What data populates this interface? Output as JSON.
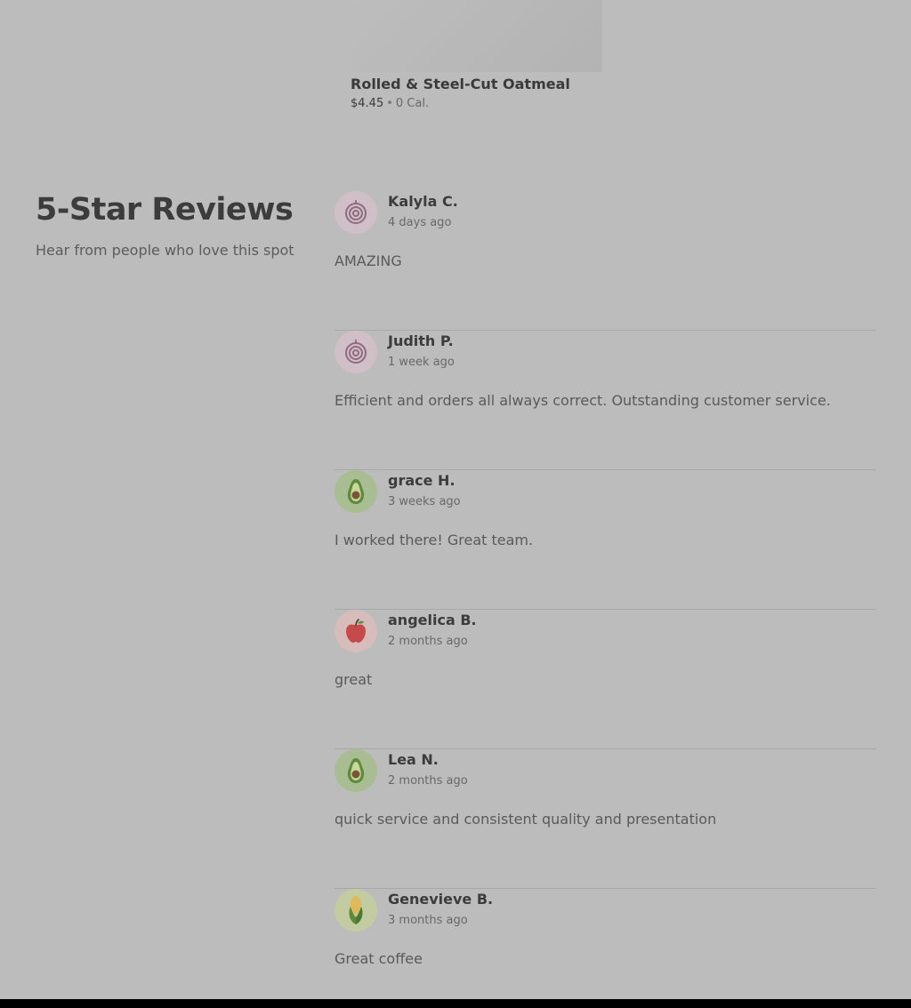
{
  "menu_item": {
    "name": "Rolled & Steel-Cut Oatmeal",
    "price": "$4.45",
    "separator": "•",
    "calories": "0 Cal."
  },
  "reviews_section": {
    "title": "5-Star Reviews",
    "subtitle": "Hear from people who love this spot"
  },
  "reviews": [
    {
      "name": "Kalyla C.",
      "date": "4 days ago",
      "text": "AMAZING",
      "avatar_icon": "onion-icon",
      "avatar_bg": "#d1bfc7"
    },
    {
      "name": "Judith P.",
      "date": "1 week ago",
      "text": "Efficient and orders all always correct. Outstanding customer service.",
      "avatar_icon": "onion-icon",
      "avatar_bg": "#d1bfc7"
    },
    {
      "name": "grace H.",
      "date": "3 weeks ago",
      "text": "I worked there! Great team.",
      "avatar_icon": "avocado-icon",
      "avatar_bg": "#a9bd92"
    },
    {
      "name": "angelica B.",
      "date": "2 months ago",
      "text": "great",
      "avatar_icon": "apple-icon",
      "avatar_bg": "#d7bcbc"
    },
    {
      "name": "Lea N.",
      "date": "2 months ago",
      "text": "quick service and consistent quality and presentation",
      "avatar_icon": "avocado-icon",
      "avatar_bg": "#a9bd92"
    },
    {
      "name": "Genevieve B.",
      "date": "3 months ago",
      "text": "Great coffee",
      "avatar_icon": "corn-icon",
      "avatar_bg": "#c3cca0"
    }
  ]
}
